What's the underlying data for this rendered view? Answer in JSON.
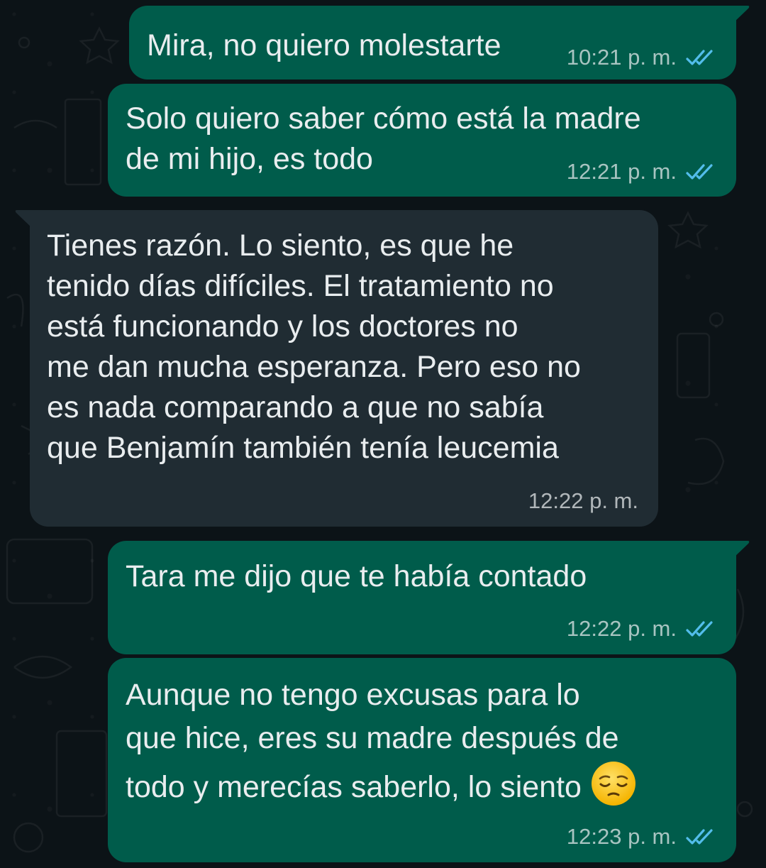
{
  "messages": [
    {
      "direction": "outgoing",
      "text": "Mira, no quiero molestarte",
      "time": "10:21 p. m.",
      "status": "read-icon"
    },
    {
      "direction": "outgoing",
      "text": "Solo quiero saber cómo está la madre\nde mi hijo, es todo",
      "time": "12:21 p. m.",
      "status": "read-icon"
    },
    {
      "direction": "incoming",
      "text": "Tienes razón. Lo siento, es que he\ntenido días difíciles. El tratamiento no\nestá funcionando y los doctores no\nme dan mucha esperanza. Pero eso no\nes nada comparando a que no sabía\nque Benjamín también tenía leucemia",
      "time": "12:22 p. m."
    },
    {
      "direction": "outgoing",
      "text": "Tara me dijo que te había contado",
      "time": "12:22 p. m.",
      "status": "read-icon"
    },
    {
      "direction": "outgoing",
      "text": "Aunque no tengo excusas para lo\nque hice, eres su madre después de\ntodo y merecías saberlo, lo siento",
      "emoji": "pensive-face-emoji",
      "time": "12:23 p. m.",
      "status": "read-icon"
    }
  ],
  "colors": {
    "background": "#0c1317",
    "outgoing_bubble": "#005c4b",
    "incoming_bubble": "#202c33",
    "text": "#e9edef",
    "read_ticks": "#53bdeb"
  }
}
